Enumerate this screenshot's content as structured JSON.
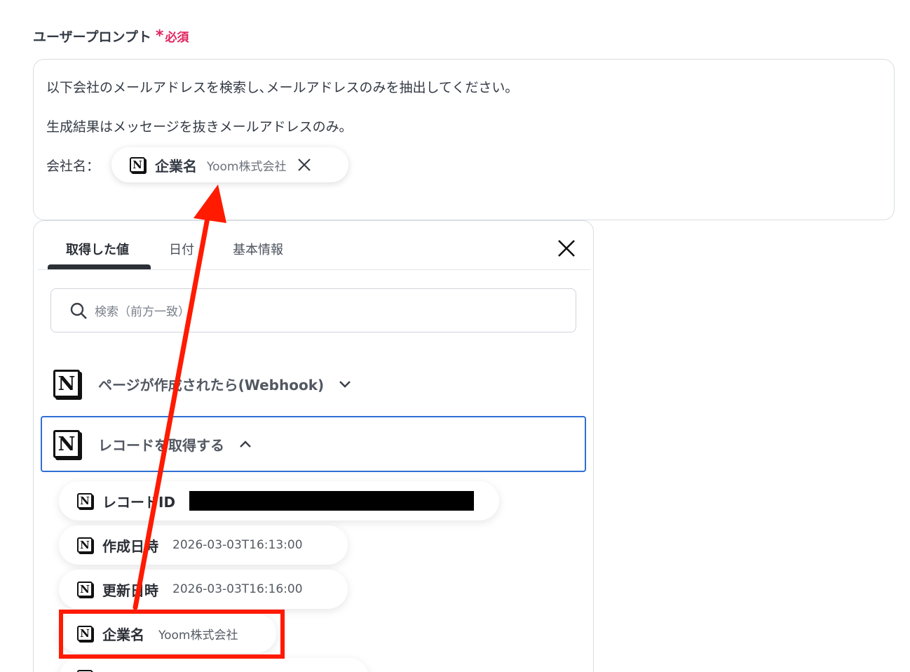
{
  "field": {
    "label": "ユーザープロンプト",
    "required_star": "*",
    "required_text": "必須"
  },
  "prompt": {
    "line1": "以下会社のメールアドレスを検索し､メールアドレスのみを抽出してください｡",
    "line2": "生成結果はメッセージを抜きメールアドレスのみ｡",
    "line3_label": "会社名：",
    "chip": {
      "icon": "notion-icon",
      "title": "企業名",
      "value": "Yoom株式会社"
    }
  },
  "panel": {
    "tabs": [
      {
        "label": "取得した値",
        "active": true
      },
      {
        "label": "日付",
        "active": false
      },
      {
        "label": "基本情報",
        "active": false
      }
    ],
    "search_placeholder": "検索（前方一致）",
    "groups": [
      {
        "title": "ページが作成されたら(Webhook)",
        "expanded": false,
        "icon": "notion-icon"
      },
      {
        "title": "レコードを取得する",
        "expanded": true,
        "icon": "notion-icon"
      }
    ],
    "items": [
      {
        "title": "レコードID",
        "value": "",
        "redacted": true
      },
      {
        "title": "作成日時",
        "value": "2026-03-03T16:13:00"
      },
      {
        "title": "更新日時",
        "value": "2026-03-03T16:16:00"
      },
      {
        "title": "企業名",
        "value": "Yoom株式会社",
        "highlighted": true
      }
    ]
  },
  "colors": {
    "required": "#e0245e",
    "annotation_red": "#ff1a00",
    "focus_blue": "#2f6fd4"
  }
}
